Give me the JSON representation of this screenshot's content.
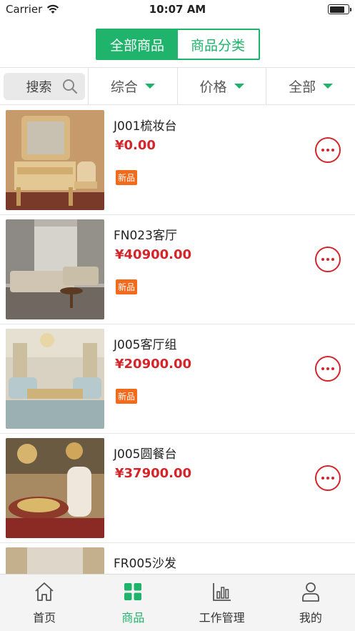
{
  "status_bar": {
    "carrier": "Carrier",
    "time": "10:07 AM"
  },
  "segments": {
    "all_products": "全部商品",
    "categories": "商品分类"
  },
  "filters": {
    "search": "搜索",
    "composite": "综合",
    "price": "价格",
    "all": "全部"
  },
  "products": [
    {
      "name": "J001梳妆台",
      "price": "¥0.00",
      "tag": "新品"
    },
    {
      "name": "FN023客厅",
      "price": "¥40900.00",
      "tag": "新品"
    },
    {
      "name": "J005客厅组",
      "price": "¥20900.00",
      "tag": "新品"
    },
    {
      "name": "J005圆餐台",
      "price": "¥37900.00"
    },
    {
      "name": "FR005沙发"
    }
  ],
  "tabs": [
    {
      "label": "首页",
      "icon": "home-icon"
    },
    {
      "label": "商品",
      "icon": "grid-icon"
    },
    {
      "label": "工作管理",
      "icon": "bar-chart-icon"
    },
    {
      "label": "我的",
      "icon": "user-icon"
    }
  ],
  "colors": {
    "accent": "#1fb36b",
    "price": "#d4252a",
    "tag": "#f26a1b"
  }
}
